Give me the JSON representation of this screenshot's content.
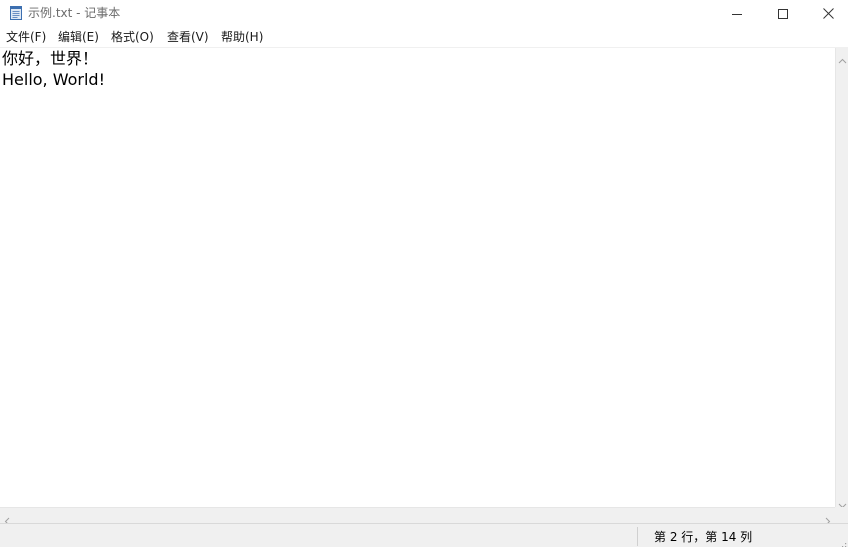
{
  "window": {
    "title": "示例.txt - 记事本",
    "icon": "notepad-icon",
    "controls": [
      "minimize-icon",
      "maximize-icon",
      "close-icon"
    ]
  },
  "menu": {
    "items": [
      {
        "label": "文件(F)"
      },
      {
        "label": "编辑(E)"
      },
      {
        "label": "格式(O)"
      },
      {
        "label": "查看(V)"
      },
      {
        "label": "帮助(H)"
      }
    ]
  },
  "editor": {
    "lines": [
      "你好，世界！",
      "Hello, World!"
    ]
  },
  "status": {
    "position": "第 2 行，第 14 列"
  },
  "colors": {
    "title_text": "#6b6b6b",
    "chrome_bg": "#f0f0f0",
    "editor_bg": "#ffffff"
  }
}
